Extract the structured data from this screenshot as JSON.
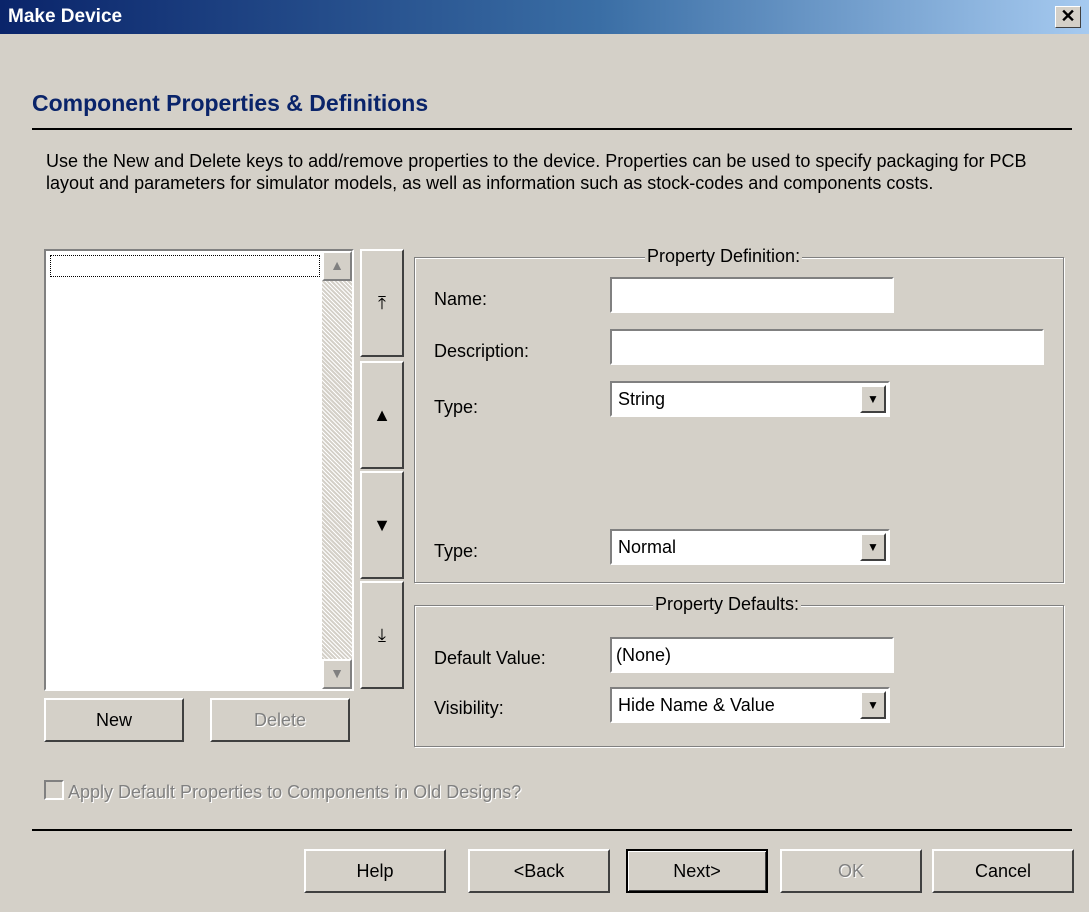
{
  "window": {
    "title": "Make Device",
    "close_glyph": "✕"
  },
  "heading": "Component Properties & Definitions",
  "intro": "Use the New and Delete keys to add/remove properties to the device. Properties can be used to specify packaging for PCB layout and parameters for simulator models, as well as information such as stock-codes and components costs.",
  "list": {
    "scroll_up_glyph": "▲",
    "scroll_down_glyph": "▼"
  },
  "move_buttons": {
    "top": "⤒",
    "up": "▲",
    "down": "▼",
    "bottom": "⤓"
  },
  "buttons": {
    "new": "New",
    "delete": "Delete"
  },
  "property_definition": {
    "legend": "Property Definition:",
    "name_label": "Name:",
    "name_value": "",
    "description_label": "Description:",
    "description_value": "",
    "type_label": "Type:",
    "type_value": "String",
    "type2_label": "Type:",
    "type2_value": "Normal"
  },
  "property_defaults": {
    "legend": "Property Defaults:",
    "default_value_label": "Default Value:",
    "default_value": "(None)",
    "visibility_label": "Visibility:",
    "visibility_value": "Hide Name & Value"
  },
  "apply_checkbox": {
    "label": "Apply Default Properties to Components in Old Designs?",
    "checked": false
  },
  "footer": {
    "help": "Help",
    "back": "<Back",
    "next": "Next>",
    "ok": "OK",
    "cancel": "Cancel"
  },
  "icons": {
    "dropdown": "▼"
  }
}
